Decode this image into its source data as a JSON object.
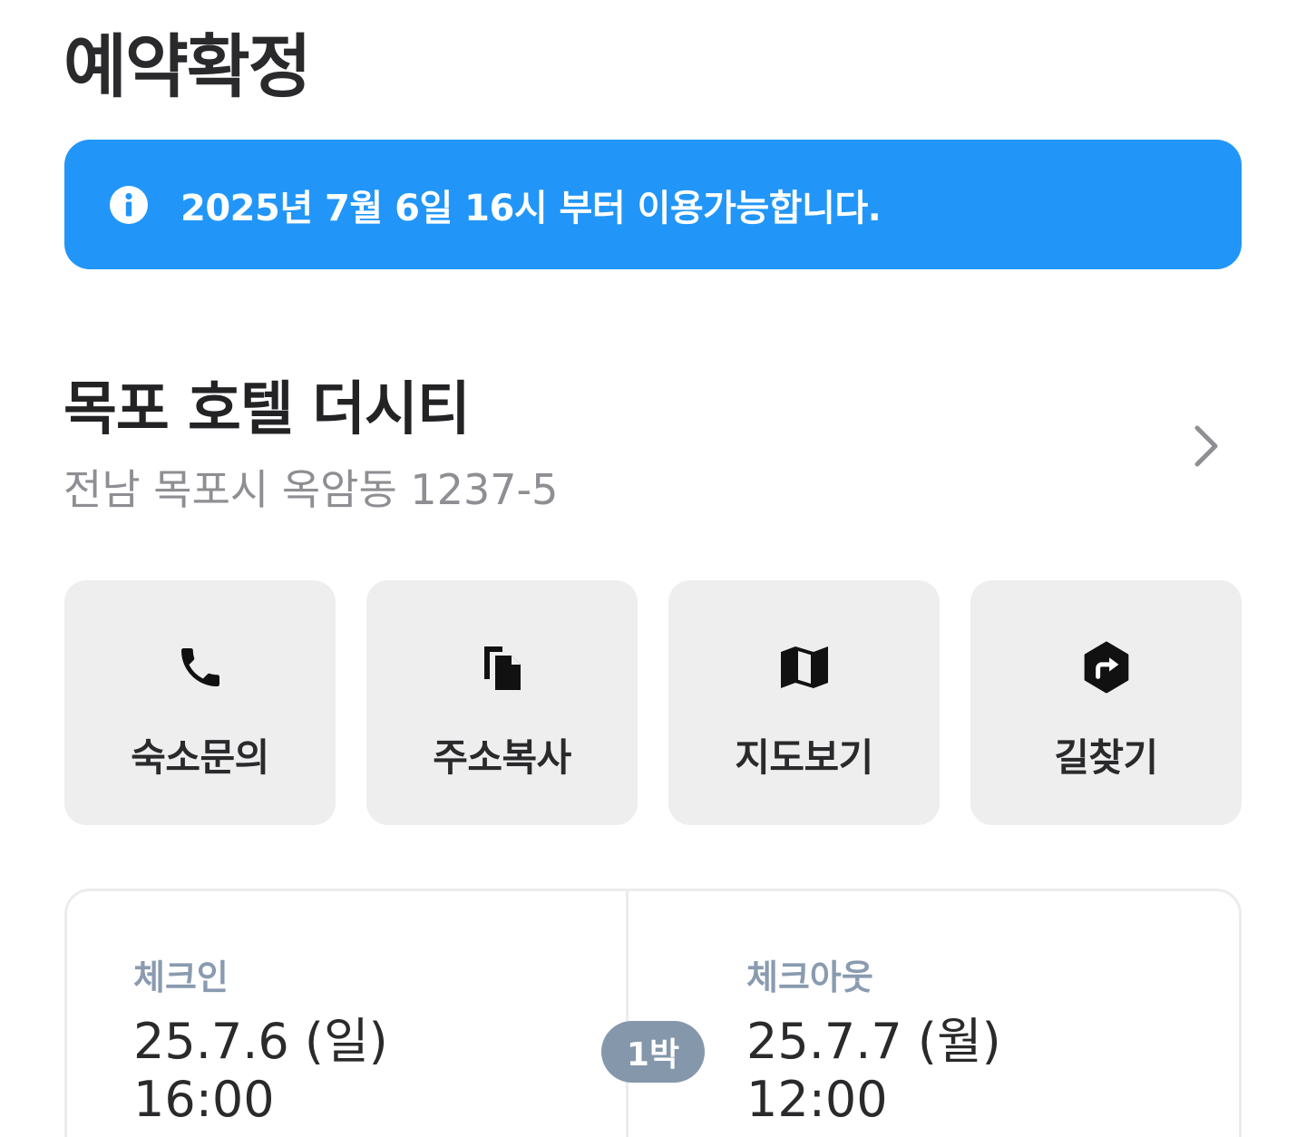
{
  "header": {
    "title": "예약확정"
  },
  "notice": {
    "icon": "info-icon",
    "text": "2025년 7월 6일 16시 부터 이용가능합니다.",
    "color": "#2196f8"
  },
  "hotel": {
    "name": "목포 호텔 더시티",
    "address": "전남 목포시 옥암동 1237-5",
    "chevron_icon": "chevron-right-icon"
  },
  "actions": [
    {
      "icon": "phone-icon",
      "label": "숙소문의"
    },
    {
      "icon": "copy-icon",
      "label": "주소복사"
    },
    {
      "icon": "map-icon",
      "label": "지도보기"
    },
    {
      "icon": "directions-icon",
      "label": "길찾기"
    }
  ],
  "stay": {
    "checkin": {
      "label": "체크인",
      "date": "25.7.6 (일)",
      "time": "16:00"
    },
    "checkout": {
      "label": "체크아웃",
      "date": "25.7.7 (월)",
      "time": "12:00"
    },
    "nights": "1박"
  }
}
